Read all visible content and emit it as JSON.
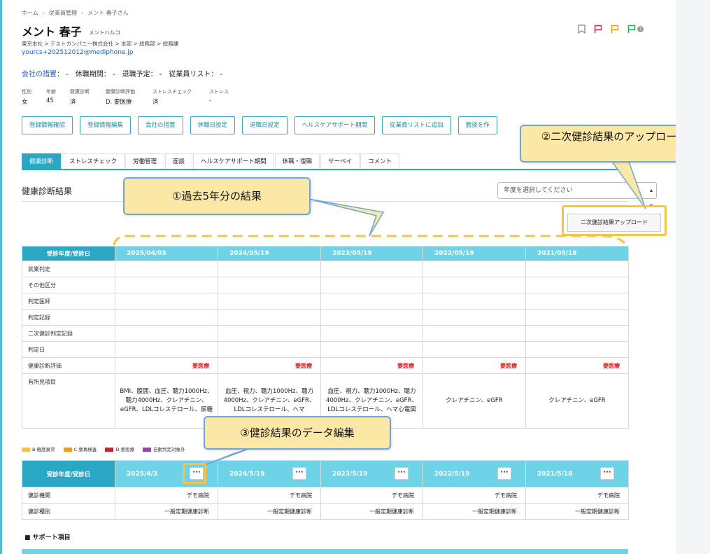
{
  "breadcrumb": [
    "ホーム",
    "従業員管理",
    "メント 春子さん"
  ],
  "employee": {
    "name": "メント 春子",
    "kana": "メントハルコ",
    "org": "東京本社 > テストカンパニー株式会社 > 本部 > 総務部 > 総務課",
    "email": "yourcs+202512012@mediphone.jp"
  },
  "status_line": {
    "measure_label": "会社の措置",
    "rest": "： -　休職期間： -　退職予定： -　従業員リスト： -"
  },
  "attributes": [
    {
      "label": "性別",
      "value": "女"
    },
    {
      "label": "年齢",
      "value": "45"
    },
    {
      "label": "健康診断",
      "value": "済"
    },
    {
      "label": "健康診断評価",
      "value": "D. 要医療"
    },
    {
      "label": "ストレスチェック",
      "value": "済"
    },
    {
      "label": "ストレス",
      "value": "-"
    }
  ],
  "actions": [
    "登録情報確認",
    "登録情報編集",
    "会社の措置",
    "休職日設定",
    "退職日設定",
    "ヘルスケアサポート期間",
    "従業員リストに追加",
    "面談を作"
  ],
  "tabs": [
    "健康診断",
    "ストレスチェック",
    "労働管理",
    "面談",
    "ヘルスケアサポート期間",
    "休職・復職",
    "サーベイ",
    "コメント"
  ],
  "section_title": "健康診断結果",
  "year_select_placeholder": "年度を選択してください",
  "upload_button": "二次健診結果アップロード",
  "table1": {
    "header_label": "受診年度/受診日",
    "dates": [
      "2025/04/03",
      "2024/05/19",
      "2023/05/19",
      "2022/05/19",
      "2021/05/18"
    ],
    "rows": [
      "就業判定",
      "その他区分",
      "判定医師",
      "判定記録",
      "二次健診判定記録",
      "判定日"
    ],
    "eval_label": "健康診断評価",
    "eval_values": [
      "要医療",
      "要医療",
      "要医療",
      "要医療",
      "要医療"
    ],
    "findings_label": "有所見項目",
    "findings": [
      "BMI、腹囲、血圧、聴力1000Hz、聴力4000Hz、クレアチニン、eGFR、LDLコレステロール、尿糖",
      "血圧、視力、聴力1000Hz、聴力4000Hz、クレアチニン、eGFR、LDLコレステロール、ヘマ",
      "血圧、視力、聴力1000Hz、聴力4000Hz、クレアチニン、eGFR、LDLコレステロール、ヘマ心電図",
      "クレアチニン、eGFR",
      "クレアチニン、eGFR"
    ]
  },
  "legend": [
    {
      "label": "B:軽度異常",
      "color": "#f5c542"
    },
    {
      "label": "C:要再検査",
      "color": "#f39c12"
    },
    {
      "label": "D:要医療",
      "color": "#d21f1f"
    },
    {
      "label": "自動判定対象外",
      "color": "#8e44ad"
    }
  ],
  "table2": {
    "header_label": "受診年度/受診日",
    "dates": [
      "2025/4/3",
      "2024/5/19",
      "2023/5/19",
      "2022/5/19",
      "2021/5/18"
    ],
    "more_label": "···",
    "rows": [
      {
        "label": "健診機関",
        "values": [
          "デモ病院",
          "デモ病院",
          "デモ病院",
          "デモ病院",
          "デモ病院"
        ]
      },
      {
        "label": "健診種別",
        "values": [
          "一般定期健康診断",
          "一般定期健康診断",
          "一般定期健康診断",
          "一般定期健康診断",
          "一般定期健康診断"
        ]
      }
    ]
  },
  "support_title": "■ サポート項目",
  "callouts": {
    "c1": "①過去5年分の結果",
    "c2": "②二次健診結果のアップロード",
    "c3": "③健診結果のデータ編集"
  }
}
